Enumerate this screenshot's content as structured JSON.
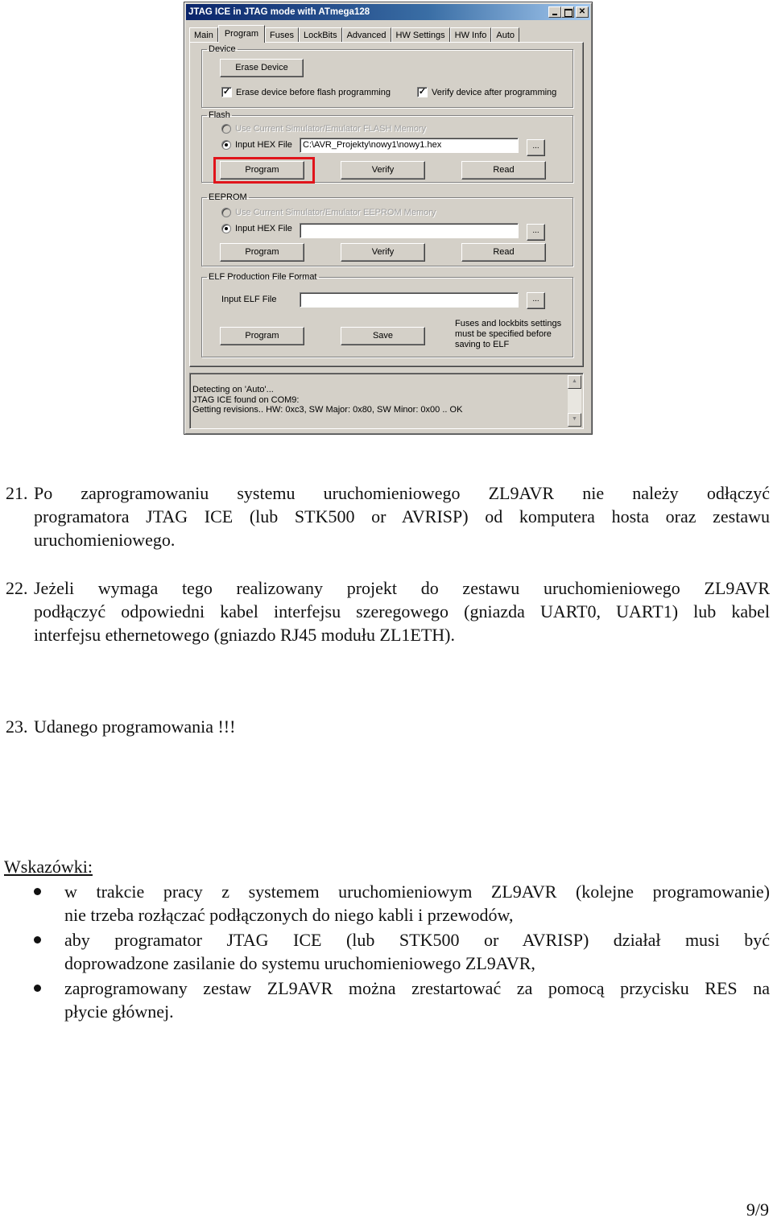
{
  "window": {
    "title": "JTAG ICE in JTAG mode with ATmega128",
    "controls": [
      "minimize",
      "maximize",
      "close"
    ],
    "tabs": [
      {
        "label": "Main",
        "active": false
      },
      {
        "label": "Program",
        "active": true
      },
      {
        "label": "Fuses",
        "active": false
      },
      {
        "label": "LockBits",
        "active": false
      },
      {
        "label": "Advanced",
        "active": false
      },
      {
        "label": "HW Settings",
        "active": false
      },
      {
        "label": "HW Info",
        "active": false
      },
      {
        "label": "Auto",
        "active": false
      }
    ],
    "device": {
      "label": "Device",
      "erase_button": "Erase Device",
      "erase_before_flash": {
        "label": "Erase device before flash programming",
        "checked": true
      },
      "verify_after": {
        "label": "Verify device after programming",
        "checked": true
      }
    },
    "flash": {
      "label": "Flash",
      "use_current_option": {
        "label": "Use Current Simulator/Emulator FLASH Memory",
        "selected": false,
        "enabled": false
      },
      "input_hex_option": {
        "label": "Input HEX File",
        "selected": true
      },
      "hex_path": "C:\\AVR_Projekty\\nowy1\\nowy1.hex",
      "browse_label": "...",
      "program_button": "Program",
      "verify_button": "Verify",
      "read_button": "Read",
      "highlight_color": "#e0141b"
    },
    "eeprom": {
      "label": "EEPROM",
      "use_current_option": {
        "label": "Use Current Simulator/Emulator EEPROM Memory",
        "selected": false,
        "enabled": false
      },
      "input_hex_option": {
        "label": "Input HEX File",
        "selected": true
      },
      "hex_path": "",
      "browse_label": "...",
      "program_button": "Program",
      "verify_button": "Verify",
      "read_button": "Read"
    },
    "elf": {
      "label": "ELF Production File Format",
      "input_label": "Input ELF File",
      "elf_path": "",
      "browse_label": "...",
      "program_button": "Program",
      "save_button": "Save",
      "note": "Fuses and lockbits settings must be specified before saving to ELF"
    },
    "log": {
      "lines": [
        "Detecting on 'Auto'...",
        "JTAG ICE found on COM9:",
        "Getting revisions.. HW: 0xc3, SW Major: 0x80, SW Minor: 0x00 .. OK"
      ],
      "scroll_up": "▲",
      "scroll_down": "▼"
    }
  },
  "document": {
    "items": [
      {
        "number": "21.",
        "lines": [
          "Po zaprogramowaniu systemu uruchomieniowego ZL9AVR nie należy odłączyć",
          "programatora JTAG ICE (lub STK500 or AVRISP) od komputera hosta oraz zestawu",
          "uruchomieniowego."
        ]
      },
      {
        "number": "22.",
        "lines": [
          "Jeżeli wymaga tego realizowany projekt do zestawu uruchomieniowego ZL9AVR",
          "podłączyć odpowiedni kabel interfejsu szeregowego (gniazda UART0, UART1) lub kabel",
          "interfejsu ethernetowego (gniazdo RJ45 modułu ZL1ETH)."
        ]
      },
      {
        "number": "23.",
        "lines": [
          "Udanego programowania !!!"
        ]
      }
    ],
    "hints_title": "Wskazówki:",
    "hints": [
      {
        "lines": [
          "w trakcie pracy z systemem uruchomieniowym ZL9AVR (kolejne programowanie)",
          "nie trzeba rozłączać podłączonych do niego kabli i przewodów,"
        ]
      },
      {
        "lines": [
          "aby programator JTAG ICE (lub STK500 or AVRISP) działał musi być",
          "doprowadzone zasilanie do systemu uruchomieniowego ZL9AVR,"
        ]
      },
      {
        "lines": [
          "zaprogramowany zestaw ZL9AVR można zrestartować za pomocą przycisku RES na",
          "płycie głównej."
        ]
      }
    ],
    "page_number": "9/9"
  }
}
